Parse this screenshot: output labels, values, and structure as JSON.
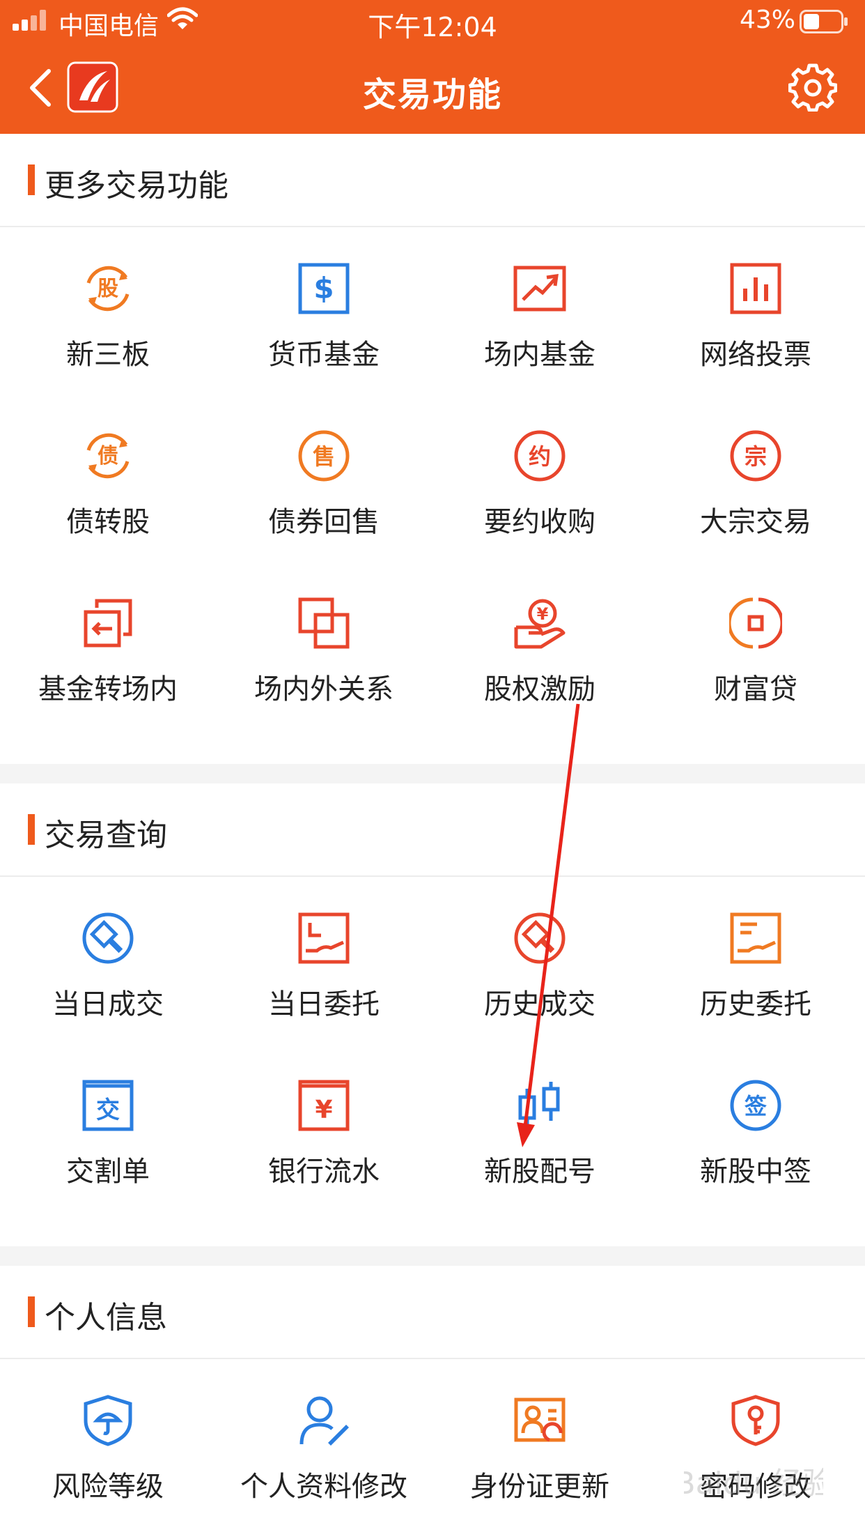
{
  "status_bar": {
    "carrier": "中国电信",
    "time": "下午12:04",
    "battery": "43%"
  },
  "navbar": {
    "title": "交易功能",
    "back_icon": "chevron-left-icon",
    "logo_icon": "app-logo-icon",
    "settings_icon": "gear-icon"
  },
  "sections": [
    {
      "title": "更多交易功能",
      "items": [
        {
          "label": "新三板",
          "icon": "stock-rotate-icon"
        },
        {
          "label": "货币基金",
          "icon": "dollar-square-icon"
        },
        {
          "label": "场内基金",
          "icon": "trend-chart-icon"
        },
        {
          "label": "网络投票",
          "icon": "bar-chart-icon"
        },
        {
          "label": "债转股",
          "icon": "bond-rotate-icon"
        },
        {
          "label": "债券回售",
          "icon": "sell-circle-icon"
        },
        {
          "label": "要约收购",
          "icon": "offer-circle-icon"
        },
        {
          "label": "大宗交易",
          "icon": "bulk-circle-icon"
        },
        {
          "label": "基金转场内",
          "icon": "transfer-icon"
        },
        {
          "label": "场内外关系",
          "icon": "overlap-squares-icon"
        },
        {
          "label": "股权激励",
          "icon": "coin-hand-icon"
        },
        {
          "label": "财富贷",
          "icon": "wealth-loan-icon"
        }
      ]
    },
    {
      "title": "交易查询",
      "items": [
        {
          "label": "当日成交",
          "icon": "gavel-circle-icon"
        },
        {
          "label": "当日委托",
          "icon": "entrust-icon"
        },
        {
          "label": "历史成交",
          "icon": "gavel-history-icon"
        },
        {
          "label": "历史委托",
          "icon": "entrust-history-icon"
        },
        {
          "label": "交割单",
          "icon": "delivery-slip-icon"
        },
        {
          "label": "银行流水",
          "icon": "yen-square-icon"
        },
        {
          "label": "新股配号",
          "icon": "candlestick-icon"
        },
        {
          "label": "新股中签",
          "icon": "lottery-circle-icon"
        }
      ]
    },
    {
      "title": "个人信息",
      "items": [
        {
          "label": "风险等级",
          "icon": "risk-shield-icon"
        },
        {
          "label": "个人资料修改",
          "icon": "user-edit-icon"
        },
        {
          "label": "身份证更新",
          "icon": "id-card-refresh-icon"
        },
        {
          "label": "密码修改",
          "icon": "key-shield-icon"
        }
      ]
    }
  ],
  "icon_glyphs": {
    "s0_0": "股",
    "s0_4": "债",
    "s0_5": "售",
    "s0_6": "约",
    "s0_7": "宗",
    "s1_4": "交",
    "s1_5": "¥",
    "s1_7": "签",
    "s0_1": "$",
    "s0_10": "¥"
  },
  "watermark": "Baidu 经验",
  "colors": {
    "accent": "#ef5a1c",
    "icon_orange": "#f07a22",
    "icon_red": "#e8452c",
    "icon_blue": "#2a7ee0",
    "divider": "#f4f4f4"
  }
}
